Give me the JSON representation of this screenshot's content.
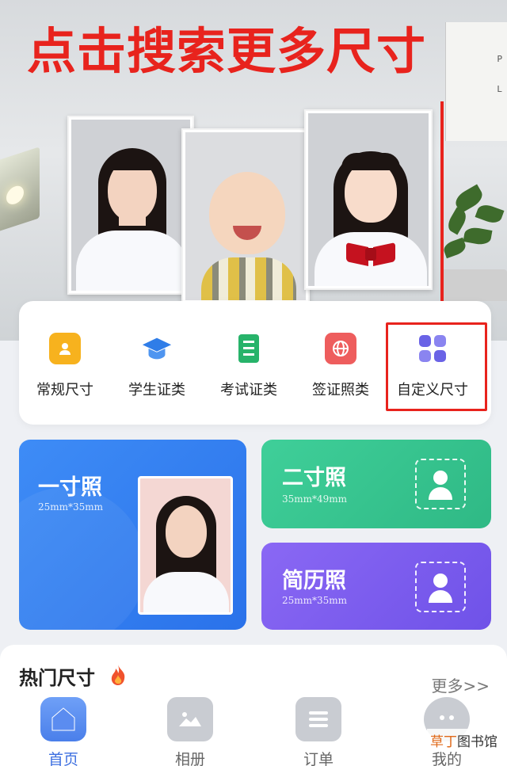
{
  "hero": {
    "headline": "点击搜索更多尺寸",
    "wall_letters": [
      "P",
      "L"
    ]
  },
  "categories": [
    {
      "label": "常规尺寸",
      "icon": "person-badge-icon",
      "color": "#f7b21e"
    },
    {
      "label": "学生证类",
      "icon": "graduation-cap-icon",
      "color": "#2f7de8"
    },
    {
      "label": "考试证类",
      "icon": "document-list-icon",
      "color": "#27b36a"
    },
    {
      "label": "签证照类",
      "icon": "globe-icon",
      "color": "#ee5d5d"
    },
    {
      "label": "自定义尺寸",
      "icon": "grid-apps-icon",
      "color": "#6a63e6"
    }
  ],
  "size_cards": {
    "one_inch": {
      "title": "一寸照",
      "size": "25mm*35mm",
      "color": "#2f7ff0"
    },
    "two_inch": {
      "title": "二寸照",
      "size": "35mm*49mm",
      "color": "#34c58f"
    },
    "resume": {
      "title": "简历照",
      "size": "25mm*35mm",
      "color": "#7a5cf0"
    }
  },
  "hot": {
    "title": "热门尺寸",
    "more": "更多>>"
  },
  "nav": [
    {
      "label": "首页",
      "icon": "home-icon",
      "active": true
    },
    {
      "label": "相册",
      "icon": "gallery-icon",
      "active": false
    },
    {
      "label": "订单",
      "icon": "order-list-icon",
      "active": false
    },
    {
      "label": "我的",
      "icon": "profile-face-icon",
      "active": false
    }
  ],
  "watermark": {
    "highlight": "草丁",
    "rest": "图书馆"
  },
  "colors": {
    "accent_red": "#e8231d",
    "blue": "#2f7ff0",
    "green": "#34c58f",
    "purple": "#7a5cf0"
  }
}
